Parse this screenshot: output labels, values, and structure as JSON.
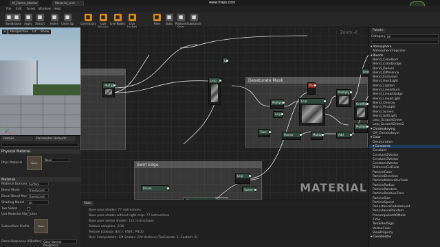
{
  "titlebar": {
    "tab1": "M_Demo_Master",
    "tab2": "Material_Inst",
    "fraps": "www.fraps.com"
  },
  "menu": [
    "File",
    "Edit",
    "Asset",
    "Window",
    "Help"
  ],
  "toolbar": [
    {
      "label": "Save",
      "icon": "save-icon"
    },
    {
      "label": "Browse",
      "icon": "folder-icon"
    },
    {
      "label": "Apply",
      "icon": "check-icon"
    },
    {
      "label": "Search",
      "icon": "search-icon"
    },
    {
      "label": "Home",
      "icon": "home-icon"
    },
    {
      "label": "Clean Up",
      "icon": "cleanup-icon"
    },
    {
      "label": "Connectors",
      "icon": "connectors-icon"
    },
    {
      "label": "Live Preview",
      "icon": "live-preview-icon"
    },
    {
      "label": "Live Nodes",
      "icon": "live-nodes-icon"
    },
    {
      "label": "Live Update",
      "icon": "live-update-icon"
    },
    {
      "label": "Hide",
      "icon": "hide-icon"
    },
    {
      "label": "Stats",
      "icon": "stats-icon"
    },
    {
      "label": "Platform Stats",
      "icon": "platform-stats-icon"
    },
    {
      "label": "Substance",
      "icon": "substance-icon"
    }
  ],
  "viewport": {
    "perspective": "Perspective",
    "lit": "Lit",
    "show": "Show"
  },
  "details": {
    "tab1": "Details",
    "tab2": "Parameter Defaults",
    "section1": "Physical Material",
    "phys_label": "Phys Material",
    "phys_thumb": "None",
    "phys_value": "None",
    "section2": "Material",
    "props": [
      {
        "label": "Material Domain",
        "value": "Surface"
      },
      {
        "label": "Blend Mode",
        "value": "Translucent"
      },
      {
        "label": "Decal Blend Mode",
        "value": "Translucent"
      },
      {
        "label": "Shading Model",
        "value": "Lit"
      },
      {
        "label": "Two Sided",
        "value": ""
      },
      {
        "label": "Use Material Attributes",
        "value": ""
      }
    ],
    "subsurface_label": "Subsurface Profile",
    "subsurface_thumb": "None",
    "decal_label": "Decal Response (DBuffer)",
    "decal_value": "Color Normal Roughness"
  },
  "graph": {
    "zoom": "Zoom -2",
    "comment1": "Desaturate Mask",
    "comment2": "Swirl Edge",
    "watermark": "MATERIAL",
    "nodes": [
      "Multiply",
      "Lerp",
      "Multiply",
      "Param",
      "Lerp",
      "Multiply",
      "Time",
      "Panner",
      "Multiply",
      "Add",
      "Param",
      "Clamp",
      "Lerp",
      "Lerp",
      "OneMinus",
      "Multiply",
      "Lerp",
      "Lerp",
      "Speed",
      "Lerp"
    ]
  },
  "stats": {
    "title": "Stats",
    "lines": [
      "Base pass shader: 77 instructions",
      "Base pass shader without light map: 77 instructions",
      "Base pass vertex shader: 111 instructions",
      "Texture samplers: 2/16",
      "Texture Lookups (Est.): VS(0), PS(2)",
      "User interpolators: 2/4 Scalars (1/4 Vectors) (TexCoords: 2, Custom: 0)"
    ]
  },
  "palette": {
    "title": "Palette",
    "category_label": "Category",
    "category_value": "All",
    "items": [
      {
        "text": "Atmosphere",
        "cat": true
      },
      {
        "text": "AtmosphericFogColor"
      },
      {
        "text": "Blends",
        "cat": true
      },
      {
        "text": "Blend_ColorBurn"
      },
      {
        "text": "Blend_ColorDodge"
      },
      {
        "text": "Blend_Darken"
      },
      {
        "text": "Blend_Difference"
      },
      {
        "text": "Blend_Exclusion"
      },
      {
        "text": "Blend_HardLight"
      },
      {
        "text": "Blend_Lighten"
      },
      {
        "text": "Blend_LinearBurn"
      },
      {
        "text": "Blend_LinearDodge"
      },
      {
        "text": "Blend_LinearLight"
      },
      {
        "text": "Blend_Overlay"
      },
      {
        "text": "Blend_PinLight"
      },
      {
        "text": "Blend_Screen"
      },
      {
        "text": "Blend_SoftLight"
      },
      {
        "text": "Lerp_ScratchGrime"
      },
      {
        "text": "Lerp_ScratchGrime2"
      },
      {
        "text": "Chromakeying",
        "cat": true
      },
      {
        "text": "CM_Chromakeyer"
      },
      {
        "text": "Color",
        "cat": true
      },
      {
        "text": "Desaturation"
      },
      {
        "text": "Constants",
        "cat": true,
        "hl": true
      },
      {
        "text": "Constant"
      },
      {
        "text": "Constant2Vector"
      },
      {
        "text": "Constant3Vector"
      },
      {
        "text": "Constant4Vector"
      },
      {
        "text": "DistanceCullFade"
      },
      {
        "text": "ParticleColor"
      },
      {
        "text": "ParticleDirection"
      },
      {
        "text": "ParticleMotionBlurFade"
      },
      {
        "text": "ParticleRadius"
      },
      {
        "text": "ParticleRandom"
      },
      {
        "text": "ParticleRelativeTime"
      },
      {
        "text": "ParticleSize"
      },
      {
        "text": "ParticleSpeed"
      },
      {
        "text": "PerInstanceFadeAmount"
      },
      {
        "text": "PerInstanceRandom"
      },
      {
        "text": "PrecomputedAOMask"
      },
      {
        "text": "Time"
      },
      {
        "text": "TwoSidedSign"
      },
      {
        "text": "VertexColor"
      },
      {
        "text": "ViewProperty"
      },
      {
        "text": "Coordinates",
        "cat": true
      }
    ]
  }
}
